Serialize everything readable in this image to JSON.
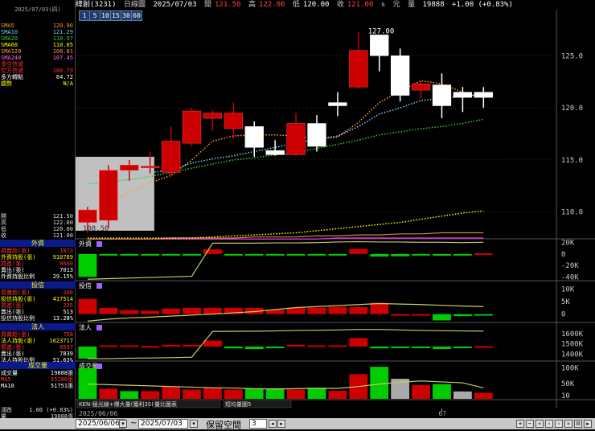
{
  "stock": {
    "name": "緯創(3231)",
    "chart_type": "日線圖",
    "date": "2025/07/03",
    "open_label": "開",
    "open": "121.50",
    "high_label": "高",
    "high": "122.00",
    "low_label": "低",
    "low": "120.00",
    "close_label": "收",
    "close": "121.00",
    "close_unit": "s",
    "vol_label": "元",
    "vol_unit": "量",
    "volume": "19888",
    "change": "+1.00 (+0.83%)"
  },
  "period_buttons": [
    "1",
    "5",
    "10",
    "15",
    "30",
    "60"
  ],
  "left_panel": {
    "date_header": "2025/07/03(四)",
    "ma_rows": [
      {
        "label": "SMA5",
        "value": "120.90",
        "color": "#ff9933"
      },
      {
        "label": "SMA10",
        "value": "121.29",
        "color": "#66ccff"
      },
      {
        "label": "SMA20",
        "value": "118.97",
        "color": "#33cc33"
      },
      {
        "label": "SMA60",
        "value": "110.05",
        "color": "#ffff00"
      },
      {
        "label": "SMA120",
        "value": "108.01",
        "color": "#ff9933"
      },
      {
        "label": "SMA240",
        "value": "107.45",
        "color": "#ff66ff"
      },
      {
        "label": "多空信號",
        "value": "",
        "color": "#ff3333"
      },
      {
        "label": "空方信號",
        "value": "100.79",
        "color": "#ff3333"
      },
      {
        "label": "多方轉點",
        "value": "64.72",
        "color": "#ffffff"
      },
      {
        "label": "趨勢",
        "value": "N/A",
        "color": "#ffff00"
      }
    ],
    "ohlc_rows": [
      {
        "label": "開",
        "value": "121.50"
      },
      {
        "label": "高",
        "value": "122.00"
      },
      {
        "label": "低",
        "value": "120.00"
      },
      {
        "label": "收",
        "value": "121.00"
      }
    ],
    "sections": [
      {
        "title": "外資",
        "rows": [
          {
            "label": "買賣超(張)",
            "value": "1073",
            "color": "#ff3333"
          },
          {
            "label": "外資持股(張)",
            "value": "910769",
            "color": "#ffff00"
          },
          {
            "label": "買進(張)",
            "value": "8660",
            "color": "#ff3333"
          },
          {
            "label": "賣出(張)",
            "value": "7013",
            "color": "#ffffff"
          },
          {
            "label": "外資持股比例",
            "value": "29.15%",
            "color": "#ffffff"
          }
        ]
      },
      {
        "title": "投信",
        "rows": [
          {
            "label": "買賣超(張)",
            "value": "-288",
            "color": "#ff3333"
          },
          {
            "label": "投信持股(張)",
            "value": "417514",
            "color": "#ffff00"
          },
          {
            "label": "買進(張)",
            "value": "225",
            "color": "#ff3333"
          },
          {
            "label": "賣出(張)",
            "value": "513",
            "color": "#ffffff"
          },
          {
            "label": "投信持股比例",
            "value": "13.28%",
            "color": "#ffffff"
          }
        ]
      },
      {
        "title": "法人",
        "rows": [
          {
            "label": "買賣超(張)",
            "value": "758",
            "color": "#ff3333"
          },
          {
            "label": "法人持股(張)",
            "value": "1623717",
            "color": "#ffff00"
          },
          {
            "label": "買進(張)",
            "value": "8597",
            "color": "#ff3333"
          },
          {
            "label": "賣出(張)",
            "value": "7839",
            "color": "#ffffff"
          },
          {
            "label": "法人持股比例",
            "value": "51.63%",
            "color": "#ffffff"
          }
        ]
      },
      {
        "title": "成交量",
        "rows": [
          {
            "label": "成交量",
            "value": "19888張",
            "color": "#ffffff"
          },
          {
            "label": "MA5",
            "value": "35280張",
            "color": "#ff3333"
          },
          {
            "label": "MA10",
            "value": "51751張",
            "color": "#ffffff"
          }
        ]
      }
    ],
    "bottom_rows": [
      {
        "label": "漲跌",
        "value": "1.00 (+0.83%)"
      },
      {
        "label": "量",
        "value": "19888張"
      }
    ]
  },
  "panel_labels": {
    "foreign": "外資",
    "trust": "投信",
    "legal": "法人",
    "volume": "成交量"
  },
  "indicator_tabs": [
    "KEN-極光線+爆大量(獲利3SP)",
    "量比圖表",
    "短均量圖5"
  ],
  "bottom_bar": {
    "start_date": "2025/06/06",
    "end_date": "2025/07/03",
    "sep": "~",
    "keep_space_label": "保留空間",
    "keep_space_value": "3"
  },
  "x_labels": {
    "left": "2025/06/06",
    "mid": "07"
  },
  "chart_data": [
    {
      "type": "candlestick",
      "title": "",
      "ylim": [
        107.5,
        128.5
      ],
      "yticks": [
        110,
        115,
        120,
        125
      ],
      "candles": [
        {
          "o": 109,
          "h": 110.5,
          "l": 108,
          "c": 110.2
        },
        {
          "o": 109.2,
          "h": 114.5,
          "l": 108.5,
          "c": 114.0
        },
        {
          "o": 114.0,
          "h": 115.0,
          "l": 113.0,
          "c": 114.5
        },
        {
          "o": 114.3,
          "h": 115.8,
          "l": 113.7,
          "c": 114.4
        },
        {
          "o": 113.8,
          "h": 118.2,
          "l": 113.5,
          "c": 116.8
        },
        {
          "o": 116.6,
          "h": 120.0,
          "l": 116.3,
          "c": 119.7
        },
        {
          "o": 119.0,
          "h": 119.8,
          "l": 117.8,
          "c": 119.5
        },
        {
          "o": 118.0,
          "h": 120.5,
          "l": 117.0,
          "c": 119.5
        },
        {
          "o": 118.2,
          "h": 118.7,
          "l": 115.3,
          "c": 116.2
        },
        {
          "o": 115.9,
          "h": 116.9,
          "l": 115.4,
          "c": 115.5
        },
        {
          "o": 115.5,
          "h": 119.5,
          "l": 115.4,
          "c": 118.5
        },
        {
          "o": 118.5,
          "h": 119.3,
          "l": 115.8,
          "c": 116.3
        },
        {
          "o": 120.5,
          "h": 121.5,
          "l": 119.2,
          "c": 120.2
        },
        {
          "o": 122.0,
          "h": 127.3,
          "l": 121.9,
          "c": 125.5
        },
        {
          "o": 127.0,
          "h": 127.0,
          "l": 123.5,
          "c": 125.0
        },
        {
          "o": 125.0,
          "h": 125.7,
          "l": 120.6,
          "c": 121.2
        },
        {
          "o": 121.7,
          "h": 122.5,
          "l": 120.9,
          "c": 122.3
        },
        {
          "o": 122.2,
          "h": 123.3,
          "l": 119.0,
          "c": 120.2
        },
        {
          "o": 121.5,
          "h": 122.0,
          "l": 119.6,
          "c": 121.0
        },
        {
          "o": 121.5,
          "h": 122.0,
          "l": 120.0,
          "c": 121.0
        }
      ],
      "annotations": [
        {
          "text": "127.00",
          "value": 127.0
        },
        {
          "text": "108.50",
          "value": 108.5
        }
      ],
      "sma5": [
        109.8,
        110.8,
        111.9,
        112.8,
        113.5,
        115.0,
        116.8,
        117.3,
        117.4,
        117.4,
        117.3,
        117.0,
        117.2,
        118.6,
        120.5,
        121.6,
        122.6,
        122.3,
        121.5,
        121.0
      ],
      "sma10": [
        113.0,
        113.4,
        113.6,
        113.8,
        114.0,
        114.7,
        115.1,
        115.4,
        115.8,
        116.2,
        116.6,
        117.0,
        117.3,
        118.2,
        119.4,
        120.0,
        120.7,
        120.9,
        121.1,
        121.3
      ],
      "sma20": [
        112.7,
        112.9,
        113.1,
        113.4,
        113.8,
        114.2,
        114.6,
        115.0,
        115.2,
        115.5,
        115.7,
        116.1,
        116.5,
        116.9,
        117.4,
        117.7,
        118.0,
        118.2,
        118.5,
        118.9
      ],
      "sma60": [
        107.5,
        107.5,
        107.5,
        107.5,
        107.5,
        107.5,
        107.6,
        107.7,
        107.8,
        107.9,
        108.0,
        108.2,
        108.4,
        108.6,
        108.8,
        109.0,
        109.3,
        109.6,
        109.9,
        110.1
      ],
      "sma120": [
        107.4,
        107.4,
        107.4,
        107.4,
        107.5,
        107.5,
        107.5,
        107.5,
        107.6,
        107.6,
        107.6,
        107.7,
        107.7,
        107.8,
        107.8,
        107.9,
        107.9,
        108.0,
        108.0,
        108.0
      ],
      "sma240": [
        107.4,
        107.4,
        107.4,
        107.4,
        107.4,
        107.4,
        107.4,
        107.4,
        107.4,
        107.4,
        107.4,
        107.4,
        107.5,
        107.5,
        107.5,
        107.5,
        107.5,
        107.5,
        107.5,
        107.5
      ]
    },
    {
      "type": "bar",
      "title": "外資",
      "ylim": [
        -45000,
        25000
      ],
      "yticks": [
        {
          "v": 20000,
          "t": "20K"
        },
        {
          "v": 0,
          "t": "0"
        },
        {
          "v": -20000,
          "t": "-20K"
        },
        {
          "v": -40000,
          "t": "-40K"
        }
      ],
      "values": [
        -40000,
        -2000,
        -1500,
        -1000,
        -1000,
        -600,
        8000,
        -2500,
        -2000,
        -2500,
        -500,
        -1000,
        -1000,
        9000,
        -4500,
        -4000,
        -1000,
        -3000,
        -1500,
        1073
      ],
      "line": [
        -45000,
        -44000,
        -43000,
        -42000,
        -41000,
        -40000,
        16000,
        16000,
        16000,
        16500,
        16500,
        17000,
        18000,
        18500,
        18000,
        18000,
        17500,
        17500,
        17000,
        17500
      ]
    },
    {
      "type": "bar",
      "title": "投信",
      "ylim": [
        -3000,
        13000
      ],
      "yticks": [
        {
          "v": 10000,
          "t": "10K"
        },
        {
          "v": 5000,
          "t": "5K"
        },
        {
          "v": 0,
          "t": "0"
        }
      ],
      "values": [
        6000,
        2500,
        1600,
        1300,
        2200,
        2500,
        2500,
        2500,
        2500,
        1700,
        2600,
        2600,
        2900,
        2800,
        4500,
        0,
        0,
        -2500,
        -800,
        -288
      ],
      "line": [
        -2800,
        -2000,
        -1500,
        -1200,
        -800,
        -400,
        0,
        500,
        1000,
        1800,
        2600,
        3000,
        3400,
        3800,
        4200,
        4000,
        3800,
        3500,
        3200,
        3000
      ]
    },
    {
      "type": "bar",
      "title": "法人",
      "ylim": [
        1340000,
        1700000
      ],
      "yticks": [
        {
          "v": 1600000,
          "t": "1600K"
        },
        {
          "v": 1500000,
          "t": "1500K"
        },
        {
          "v": 1400000,
          "t": "1400K"
        }
      ],
      "values": [
        -20000,
        2000,
        2000,
        1000,
        3000,
        3000,
        10000,
        -3000,
        -4000,
        -2000,
        3000,
        2000,
        2000,
        14000,
        -3000,
        -2000,
        -1000,
        -4000,
        -1000,
        758
      ],
      "line": [
        1355000,
        1355000,
        1360000,
        1362000,
        1365000,
        1370000,
        1620000,
        1622000,
        1623000,
        1625000,
        1630000,
        1632000,
        1635000,
        1640000,
        1640000,
        1635000,
        1630000,
        1627000,
        1625000,
        1623717
      ]
    },
    {
      "type": "bar",
      "title": "成交量",
      "ylim": [
        0,
        120000
      ],
      "yticks": [
        {
          "v": 100000,
          "t": "100K"
        },
        {
          "v": 50000,
          "t": "50K"
        },
        {
          "v": 10000,
          "t": "10"
        }
      ],
      "values": [
        100000,
        33000,
        25000,
        25000,
        40000,
        30000,
        35000,
        30000,
        33000,
        34000,
        30000,
        36000,
        26000,
        80000,
        104000,
        65000,
        45000,
        48000,
        24000,
        19888
      ],
      "up": [
        1,
        1,
        0,
        1,
        1,
        1,
        1,
        1,
        0,
        0,
        1,
        0,
        1,
        1,
        0,
        0,
        1,
        0,
        0,
        1
      ],
      "ma": [
        48000,
        46000,
        44000,
        42000,
        40000,
        38000,
        36000,
        35000,
        33000,
        32000,
        33000,
        34000,
        34000,
        40000,
        48000,
        54000,
        58000,
        55000,
        52000,
        35280
      ]
    }
  ],
  "colors": {
    "up": "#cc0000",
    "down": "#ffffff",
    "green": "#00cc00",
    "label": "#ffff66",
    "grid": "#3a3a3a"
  }
}
